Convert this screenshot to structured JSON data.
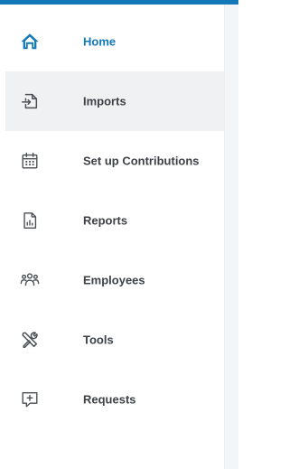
{
  "colors": {
    "accent": "#1378b8",
    "text": "#3d4146",
    "icon": "#4a4e54",
    "hover_bg": "#f0f1f2"
  },
  "sidebar": {
    "items": [
      {
        "label": "Home",
        "icon": "home-icon",
        "active": true
      },
      {
        "label": "Imports",
        "icon": "import-icon",
        "hovered": true
      },
      {
        "label": "Set up Contributions",
        "icon": "calendar-icon"
      },
      {
        "label": "Reports",
        "icon": "report-icon"
      },
      {
        "label": "Employees",
        "icon": "employees-icon"
      },
      {
        "label": "Tools",
        "icon": "tools-icon"
      },
      {
        "label": "Requests",
        "icon": "request-icon"
      }
    ]
  }
}
